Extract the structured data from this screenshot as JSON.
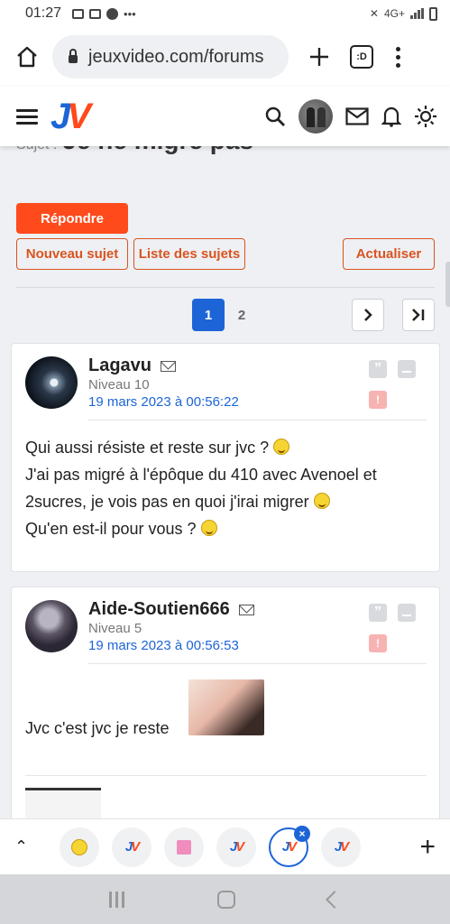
{
  "status_bar": {
    "time": "01:27",
    "network": "4G+"
  },
  "browser": {
    "url": "jeuxvideo.com/forums",
    "tabs_label": ":D"
  },
  "site": {
    "logo_j": "J",
    "logo_v": "V"
  },
  "topic": {
    "subject_label": "Sujet :",
    "title": "Je ne migre pas"
  },
  "actions": {
    "reply": "Répondre",
    "new_topic": "Nouveau sujet",
    "topic_list": "Liste des sujets",
    "refresh": "Actualiser"
  },
  "pagination": {
    "current": "1",
    "next_page": "2",
    "next": "❯",
    "last": "❯|"
  },
  "posts": [
    {
      "author": "Lagavu",
      "level": "Niveau 10",
      "date": "19 mars 2023 à 00:56:22",
      "lines": [
        "Qui aussi résiste et reste sur jvc ?",
        "J'ai pas migré à l'épôque du 410 avec Avenoel et 2sucres, je vois pas en quoi j'irai migrer",
        "Qu'en est-il pour vous ?"
      ]
    },
    {
      "author": "Aide-Soutien666",
      "level": "Niveau 5",
      "date": "19 mars 2023 à 00:56:53",
      "lines": [
        "Jvc c'est jvc je reste"
      ]
    }
  ],
  "post_actions": {
    "quote": "”",
    "alert": "!"
  },
  "tabstrip": {
    "up": "⌃",
    "add": "+",
    "close": "×"
  },
  "colors": {
    "brand_blue": "#1d64d7",
    "brand_orange": "#ff4a1c"
  }
}
